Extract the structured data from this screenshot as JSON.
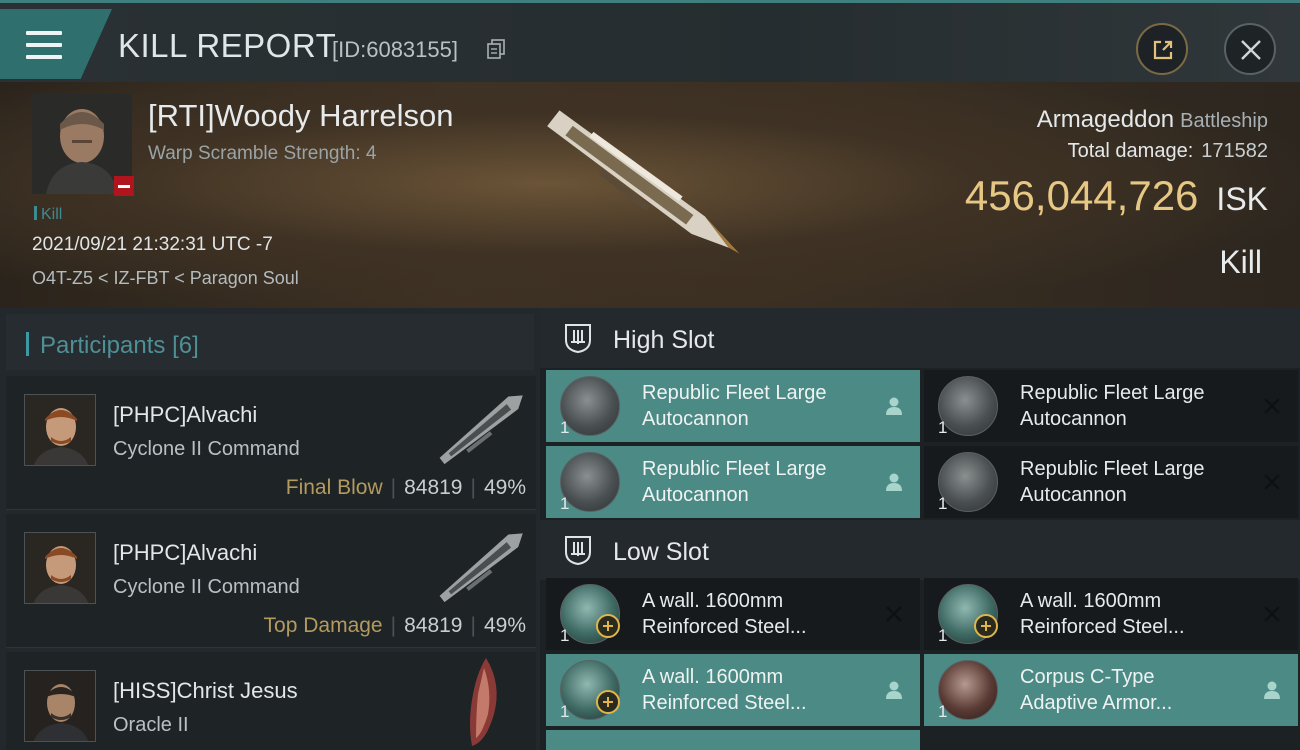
{
  "topbar": {
    "title": "KILL REPORT",
    "report_id": "[ID:6083155]",
    "menu_icon": "hamburger-menu-icon",
    "share_icon": "share-icon",
    "close_icon": "close-icon"
  },
  "victim": {
    "name": "[RTI]Woody Harrelson",
    "scramble": "Warp Scramble Strength: 4",
    "kill_tag": "Kill",
    "timestamp": "2021/09/21 21:32:31 UTC -7",
    "location": "O4T-Z5 < IZ-FBT < Paragon Soul",
    "ship_name": "Armageddon",
    "ship_class": "Battleship",
    "total_damage_label": "Total damage:",
    "total_damage": "171582",
    "isk_value": "456,044,726",
    "isk_unit": "ISK",
    "result": "Kill"
  },
  "participants": {
    "label": "Participants",
    "count": "[6]",
    "items": [
      {
        "name": "[PHPC]Alvachi",
        "ship": "Cyclone II Command",
        "tag": "Final Blow",
        "damage": "84819",
        "percent": "49%"
      },
      {
        "name": "[PHPC]Alvachi",
        "ship": "Cyclone II Command",
        "tag": "Top Damage",
        "damage": "84819",
        "percent": "49%"
      },
      {
        "name": "[HISS]Christ Jesus",
        "ship": "Oracle II",
        "tag": "",
        "damage": "",
        "percent": ""
      }
    ]
  },
  "high_slot": {
    "title": "High Slot",
    "modules": [
      {
        "line1": "Republic Fleet Large",
        "line2": "Autocannon",
        "qty": "1",
        "status": "pilot-icon"
      },
      {
        "line1": "Republic Fleet Large",
        "line2": "Autocannon",
        "qty": "1",
        "status": "destroyed-x-icon"
      },
      {
        "line1": "Republic Fleet Large",
        "line2": "Autocannon",
        "qty": "1",
        "status": "pilot-icon"
      },
      {
        "line1": "Republic Fleet Large",
        "line2": "Autocannon",
        "qty": "1",
        "status": "destroyed-x-icon"
      }
    ]
  },
  "low_slot": {
    "title": "Low Slot",
    "modules": [
      {
        "line1": "A wall. 1600mm",
        "line2": "Reinforced Steel...",
        "qty": "1",
        "status": "destroyed-x-icon"
      },
      {
        "line1": "A wall. 1600mm",
        "line2": "Reinforced Steel...",
        "qty": "1",
        "status": "destroyed-x-icon"
      },
      {
        "line1": "A wall. 1600mm",
        "line2": "Reinforced Steel...",
        "qty": "1",
        "status": "pilot-icon"
      },
      {
        "line1": "Corpus C-Type",
        "line2": "Adaptive Armor...",
        "qty": "1",
        "status": "pilot-icon"
      }
    ]
  },
  "colors": {
    "accent_teal": "#3d9aa3",
    "dropped_highlight": "#4c8a86",
    "isk_gold": "#e6c784",
    "tag_gold": "#b39a5e",
    "badge_red": "#b0151d"
  }
}
